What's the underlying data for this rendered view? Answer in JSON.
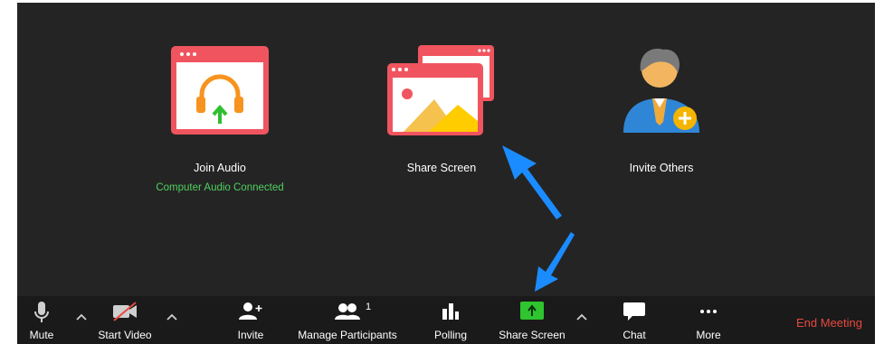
{
  "options": {
    "join_audio": {
      "label": "Join Audio",
      "status": "Computer Audio Connected"
    },
    "share_screen": {
      "label": "Share Screen"
    },
    "invite_others": {
      "label": "Invite Others"
    }
  },
  "toolbar": {
    "mute": "Mute",
    "start_video": "Start Video",
    "invite": "Invite",
    "manage_participants": "Manage Participants",
    "participants_count": "1",
    "polling": "Polling",
    "share_screen": "Share Screen",
    "chat": "Chat",
    "more": "More",
    "end_meeting": "End Meeting"
  },
  "colors": {
    "accent_red": "#f0555f",
    "status_green": "#4fd15f",
    "share_green": "#2fc52f",
    "end_red": "#e8493f",
    "annotation_blue": "#1a8cff"
  }
}
